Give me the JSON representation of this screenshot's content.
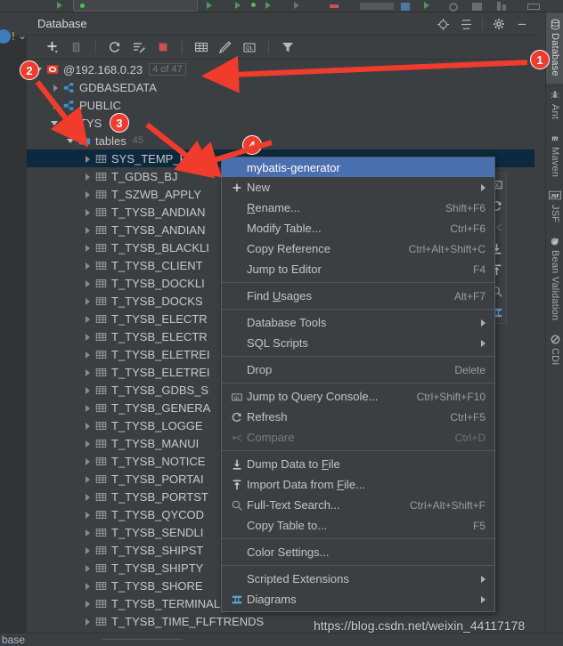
{
  "window": {
    "tool_window_title": "Database",
    "status_bar_text": "base",
    "watermark": "https://blog.csdn.net/weixin_44117178"
  },
  "header_icons": [
    {
      "name": "locate-icon",
      "label": "Jump to Console"
    },
    {
      "name": "collapse-all-icon",
      "label": "Collapse All"
    },
    {
      "name": "gear-icon",
      "label": "Settings"
    },
    {
      "name": "minimize-icon",
      "label": "Hide"
    }
  ],
  "toolbar_icons": [
    {
      "name": "add-icon",
      "label": "New"
    },
    {
      "name": "copy-icon",
      "label": "Duplicate"
    },
    {
      "name": "refresh-icon",
      "label": "Refresh"
    },
    {
      "name": "sync-edit-icon",
      "label": "Modify"
    },
    {
      "name": "stop-icon",
      "label": "Stop"
    },
    {
      "name": "table-grid-icon",
      "label": "Open Table Editor"
    },
    {
      "name": "edit-pencil-icon",
      "label": "Edit"
    },
    {
      "name": "ql-console-icon",
      "label": "Query Console"
    },
    {
      "name": "filter-icon",
      "label": "Filter"
    }
  ],
  "float_toolbar_icons": [
    {
      "name": "ql-console-icon",
      "label": "Jump to Query Console"
    },
    {
      "name": "refresh-icon",
      "label": "Refresh"
    },
    {
      "name": "compare-icon",
      "label": "Compare"
    },
    {
      "name": "dump-data-icon",
      "label": "Dump Data to File"
    },
    {
      "name": "import-data-icon",
      "label": "Import Data from File"
    },
    {
      "name": "search-icon",
      "label": "Full-Text Search"
    },
    {
      "name": "diagram-icon",
      "label": "Diagrams"
    }
  ],
  "tree": {
    "connection": {
      "label": "@192.168.0.23",
      "badge": "4 of 47",
      "expanded": true
    },
    "schemas": [
      {
        "label": "GDBASEDATA",
        "expanded": false
      },
      {
        "label": "PUBLIC",
        "expanded": false
      },
      {
        "label": "TYS",
        "expanded": true
      }
    ],
    "tables_folder": {
      "label": "tables",
      "count": "45",
      "expanded": true
    },
    "tables": [
      {
        "label": "SYS_TEMP_FBT",
        "selected": true
      },
      {
        "label": "T_GDBS_BJ",
        "selected": false
      },
      {
        "label": "T_SZWB_APPLY",
        "selected": false
      },
      {
        "label": "T_TYSB_ANDIAN",
        "selected": false
      },
      {
        "label": "T_TYSB_ANDIAN",
        "selected": false
      },
      {
        "label": "T_TYSB_BLACKLI",
        "selected": false
      },
      {
        "label": "T_TYSB_CLIENT",
        "selected": false
      },
      {
        "label": "T_TYSB_DOCKLI",
        "selected": false
      },
      {
        "label": "T_TYSB_DOCKS",
        "selected": false
      },
      {
        "label": "T_TYSB_ELECTR",
        "selected": false
      },
      {
        "label": "T_TYSB_ELECTR",
        "selected": false
      },
      {
        "label": "T_TYSB_ELETREI",
        "selected": false
      },
      {
        "label": "T_TYSB_ELETREI",
        "selected": false
      },
      {
        "label": "T_TYSB_GDBS_S",
        "selected": false
      },
      {
        "label": "T_TYSB_GENERA",
        "selected": false
      },
      {
        "label": "T_TYSB_LOGGE",
        "selected": false
      },
      {
        "label": "T_TYSB_MANUI",
        "selected": false
      },
      {
        "label": "T_TYSB_NOTICE",
        "selected": false
      },
      {
        "label": "T_TYSB_PORTAI",
        "selected": false
      },
      {
        "label": "T_TYSB_PORTST",
        "selected": false
      },
      {
        "label": "T_TYSB_QYCOD",
        "selected": false
      },
      {
        "label": "T_TYSB_SENDLI",
        "selected": false
      },
      {
        "label": "T_TYSB_SHIPST",
        "selected": false
      },
      {
        "label": "T_TYSB_SHIPTY",
        "selected": false
      },
      {
        "label": "T_TYSB_SHORE",
        "selected": false
      },
      {
        "label": "T_TYSB_TERMINALREPORTING",
        "selected": false
      },
      {
        "label": "T_TYSB_TIME_FLFTRENDS",
        "selected": false
      }
    ]
  },
  "context_menu": {
    "items": [
      {
        "label": "mybatis-generator",
        "shortcut": "",
        "icon": "",
        "highlight": true,
        "submenu": false,
        "disabled": false
      },
      {
        "label": "New",
        "shortcut": "",
        "icon": "plus-icon",
        "highlight": false,
        "submenu": true,
        "disabled": false
      },
      {
        "label": "Rename...",
        "shortcut": "Shift+F6",
        "icon": "",
        "highlight": false,
        "submenu": false,
        "disabled": false,
        "mnemonic": "R"
      },
      {
        "label": "Modify Table...",
        "shortcut": "Ctrl+F6",
        "icon": "",
        "highlight": false,
        "submenu": false,
        "disabled": false
      },
      {
        "label": "Copy Reference",
        "shortcut": "Ctrl+Alt+Shift+C",
        "icon": "",
        "highlight": false,
        "submenu": false,
        "disabled": false
      },
      {
        "label": "Jump to Editor",
        "shortcut": "F4",
        "icon": "",
        "highlight": false,
        "submenu": false,
        "disabled": false
      },
      {
        "separator": true
      },
      {
        "label": "Find Usages",
        "shortcut": "Alt+F7",
        "icon": "",
        "highlight": false,
        "submenu": false,
        "disabled": false,
        "mnemonic": "U"
      },
      {
        "separator": true
      },
      {
        "label": "Database Tools",
        "shortcut": "",
        "icon": "",
        "highlight": false,
        "submenu": true,
        "disabled": false
      },
      {
        "label": "SQL Scripts",
        "shortcut": "",
        "icon": "",
        "highlight": false,
        "submenu": true,
        "disabled": false
      },
      {
        "separator": true
      },
      {
        "label": "Drop",
        "shortcut": "Delete",
        "icon": "",
        "highlight": false,
        "submenu": false,
        "disabled": false
      },
      {
        "separator": true
      },
      {
        "label": "Jump to Query Console...",
        "shortcut": "Ctrl+Shift+F10",
        "icon": "ql-console-icon",
        "highlight": false,
        "submenu": false,
        "disabled": false
      },
      {
        "label": "Refresh",
        "shortcut": "Ctrl+F5",
        "icon": "refresh-icon",
        "highlight": false,
        "submenu": false,
        "disabled": false
      },
      {
        "label": "Compare",
        "shortcut": "Ctrl+D",
        "icon": "compare-icon",
        "highlight": false,
        "submenu": false,
        "disabled": true
      },
      {
        "separator": true
      },
      {
        "label": "Dump Data to File",
        "shortcut": "",
        "icon": "dump-data-icon",
        "highlight": false,
        "submenu": false,
        "disabled": false,
        "mnemonic": "F"
      },
      {
        "label": "Import Data from File...",
        "shortcut": "",
        "icon": "import-data-icon",
        "highlight": false,
        "submenu": false,
        "disabled": false,
        "mnemonic": "F"
      },
      {
        "label": "Full-Text Search...",
        "shortcut": "Ctrl+Alt+Shift+F",
        "icon": "search-icon",
        "highlight": false,
        "submenu": false,
        "disabled": false
      },
      {
        "label": "Copy Table to...",
        "shortcut": "F5",
        "icon": "",
        "highlight": false,
        "submenu": false,
        "disabled": false
      },
      {
        "separator": true
      },
      {
        "label": "Color Settings...",
        "shortcut": "",
        "icon": "",
        "highlight": false,
        "submenu": false,
        "disabled": false
      },
      {
        "separator": true
      },
      {
        "label": "Scripted Extensions",
        "shortcut": "",
        "icon": "",
        "highlight": false,
        "submenu": true,
        "disabled": false
      },
      {
        "label": "Diagrams",
        "shortcut": "",
        "icon": "diagram-icon",
        "highlight": false,
        "submenu": true,
        "disabled": false
      }
    ]
  },
  "right_tool_tabs": [
    {
      "label": "Database",
      "icon": "database-icon",
      "active": true
    },
    {
      "label": "Ant",
      "icon": "ant-icon",
      "active": false
    },
    {
      "label": "Maven",
      "icon": "maven-icon",
      "active": false
    },
    {
      "label": "JSF",
      "icon": "jsf-icon",
      "active": false
    },
    {
      "label": "Bean Validation",
      "icon": "bean-validation-icon",
      "active": false
    },
    {
      "label": "CDI",
      "icon": "cdi-icon",
      "active": false
    }
  ],
  "annotations": [
    {
      "id": "1",
      "label": "1"
    },
    {
      "id": "2",
      "label": "2"
    },
    {
      "id": "3",
      "label": "3"
    },
    {
      "id": "4",
      "label": "4"
    }
  ],
  "colors": {
    "background": "#3c3f41",
    "selection": "#0d293e",
    "menu_highlight": "#4b6eaf",
    "annotation_red": "#f03b2d",
    "schema_icon": "#3d93d4",
    "stop_red": "#c75450"
  }
}
